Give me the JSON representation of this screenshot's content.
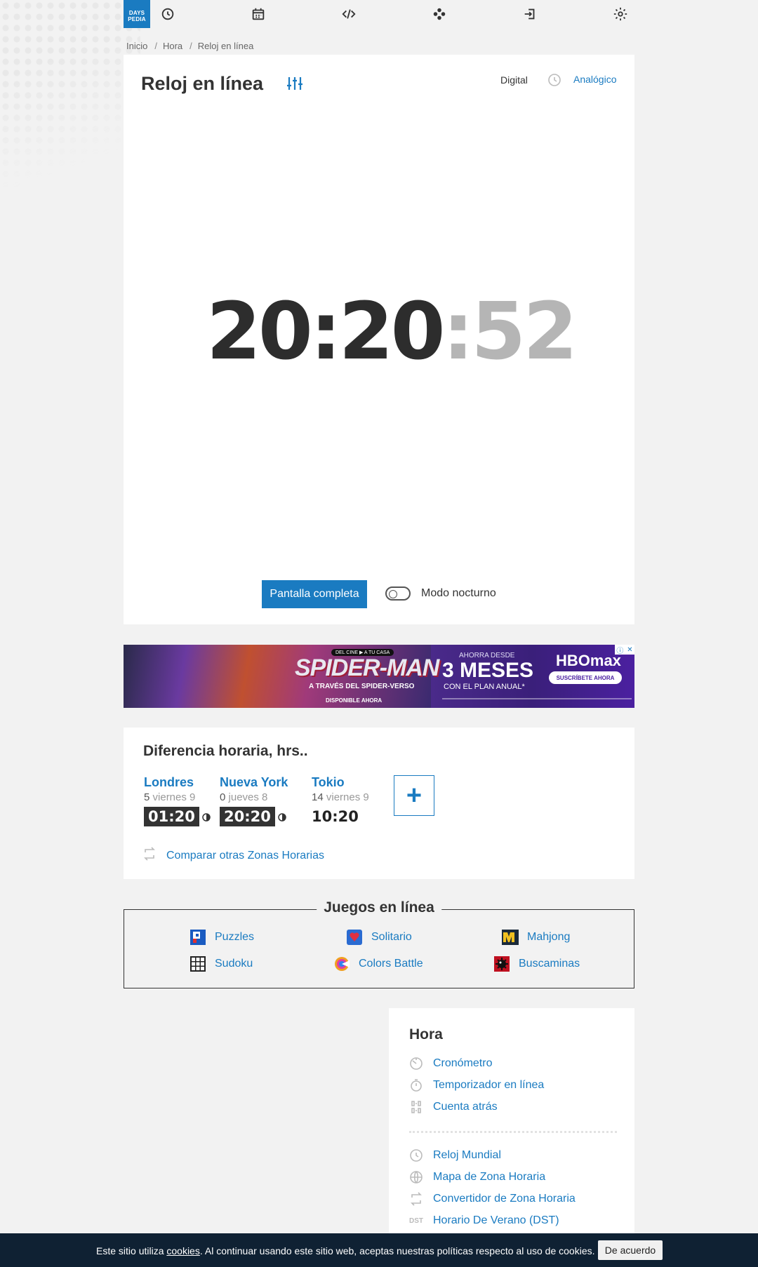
{
  "logo": {
    "line1": "DAYS",
    "line2": "PEDIA"
  },
  "nav": {
    "icons": [
      "clock-icon",
      "calendar-icon",
      "code-icon",
      "games-icon",
      "login-icon",
      "gear-icon"
    ]
  },
  "breadcrumb": {
    "items": [
      "Inicio",
      "Hora",
      "Reloj en línea"
    ]
  },
  "clock": {
    "title": "Reloj en línea",
    "mode_digital": "Digital",
    "mode_analog": "Analógico",
    "time_hm": "20:20",
    "time_sec": ":52",
    "fullscreen_label": "Pantalla completa",
    "night_mode_label": "Modo nocturno",
    "night_mode_on": false
  },
  "ad": {
    "tag": "DEL CINE ▶ A TU CASA",
    "title": "SPIDER-MAN",
    "subtitle": "A TRAVÉS DEL SPIDER-VERSO",
    "available": "DISPONIBLE AHORA",
    "ahora": "AHORRA DESDE",
    "meses": "3 MESES",
    "plan": "CON EL PLAN ANUAL*",
    "brand": "HBOmax",
    "cta": "SUSCRÍBETE AHORA"
  },
  "diff": {
    "title": "Diferencia horaria, hrs..",
    "cities": [
      {
        "name": "Londres",
        "offset": "5",
        "day": "viernes 9",
        "time": "01:20",
        "night": true
      },
      {
        "name": "Nueva York",
        "offset": "0",
        "day": "jueves 8",
        "time": "20:20",
        "night": true
      },
      {
        "name": "Tokio",
        "offset": "14",
        "day": "viernes 9",
        "time": "10:20",
        "night": false
      }
    ],
    "add_label": "+",
    "compare_label": "Comparar otras Zonas Horarias"
  },
  "games": {
    "title": "Juegos en línea",
    "items": [
      "Puzzles",
      "Solitario",
      "Mahjong",
      "Sudoku",
      "Colors Battle",
      "Buscaminas"
    ]
  },
  "hora": {
    "title": "Hora",
    "group1": [
      "Cronómetro",
      "Temporizador en línea",
      "Cuenta atrás"
    ],
    "group2": [
      "Reloj Mundial",
      "Mapa de Zona Horaria",
      "Convertidor de Zona Horaria",
      "Horario De Verano (DST)"
    ],
    "dst_badge": "DST"
  },
  "cookie": {
    "text_before": "Este sitio utiliza ",
    "link": "cookies",
    "text_after": ". Al continuar usando este sitio web, aceptas nuestras políticas respecto al uso de cookies.",
    "button": "De acuerdo"
  },
  "colors": {
    "accent": "#1a7bc1",
    "dark": "#333333",
    "cookie_bg": "#0f2133"
  }
}
